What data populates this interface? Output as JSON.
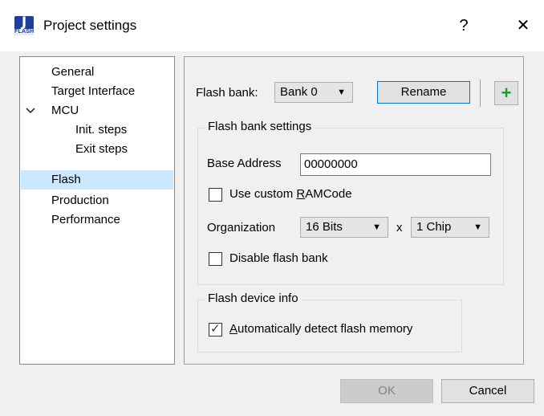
{
  "window": {
    "title": "Project settings",
    "help_glyph": "?",
    "close_glyph": "✕",
    "icon_letter": "J",
    "icon_band_text": "FLASH"
  },
  "tree": {
    "items": [
      {
        "label": "General",
        "selected": false
      },
      {
        "label": "Target Interface",
        "selected": false
      },
      {
        "label": "MCU",
        "selected": false,
        "expanded": true
      },
      {
        "label": "Init. steps",
        "selected": false
      },
      {
        "label": "Exit steps",
        "selected": false
      },
      {
        "label": "Flash",
        "selected": true
      },
      {
        "label": "Production",
        "selected": false
      },
      {
        "label": "Performance",
        "selected": false
      }
    ]
  },
  "flash_bank": {
    "label": "Flash bank:",
    "value": "Bank 0",
    "rename_label": "Rename",
    "add_glyph": "+"
  },
  "bank_settings": {
    "title": "Flash bank settings",
    "base_address_label": "Base Address",
    "base_address_value": "00000000",
    "custom_ramcode": {
      "prefix": "Use custom ",
      "accel": "R",
      "suffix": "AMCode",
      "checked": false
    },
    "organization_label": "Organization",
    "organization_bits": "16 Bits",
    "times": "x",
    "organization_chips": "1 Chip",
    "disable_label": "Disable flash bank",
    "disable_checked": false
  },
  "device_info": {
    "title": "Flash device info",
    "auto_detect": {
      "accel": "A",
      "suffix": "utomatically detect flash memory",
      "checked": true
    }
  },
  "footer": {
    "ok_label": "OK",
    "cancel_label": "Cancel"
  },
  "colors": {
    "selection": "#cce8ff",
    "add_icon": "#1e9a2e",
    "icon_bg": "#1f3e9c"
  }
}
